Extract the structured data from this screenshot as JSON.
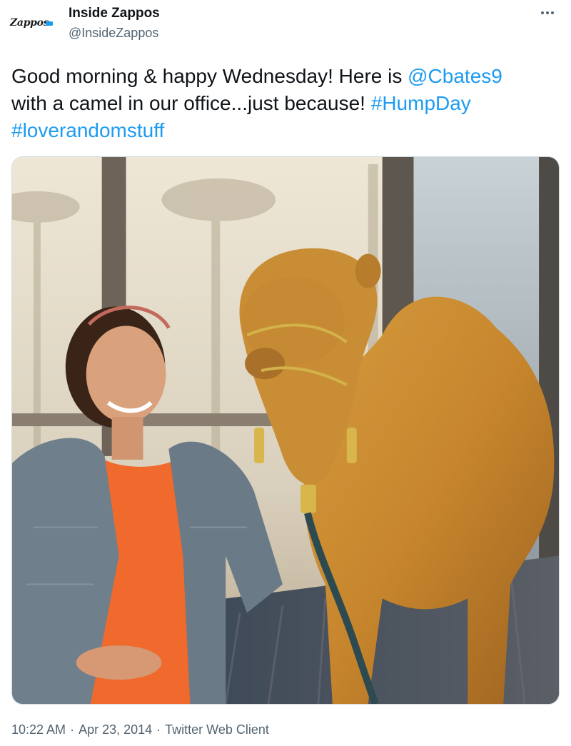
{
  "author": {
    "name": "Inside Zappos",
    "handle": "@InsideZappos",
    "avatar_logo_text": "Zappos",
    "avatar_icon": "zappos-logo-icon"
  },
  "more_icon": "more-horizontal-icon",
  "tweet": {
    "text_1": "Good morning & happy Wednesday! Here is ",
    "mention": "@Cbates9",
    "text_2": " with a camel in our office...just because! ",
    "hashtag_1": "#HumpDay",
    "hashtag_2": "#loverandomstuff"
  },
  "media": {
    "icon": "photo-image"
  },
  "meta": {
    "time": "10:22 AM",
    "separator": "·",
    "date": "Apr 23, 2014",
    "source": "Twitter Web Client"
  },
  "colors": {
    "link": "#1d9bf0",
    "secondary_text": "#536471",
    "primary_text": "#0f1419"
  }
}
